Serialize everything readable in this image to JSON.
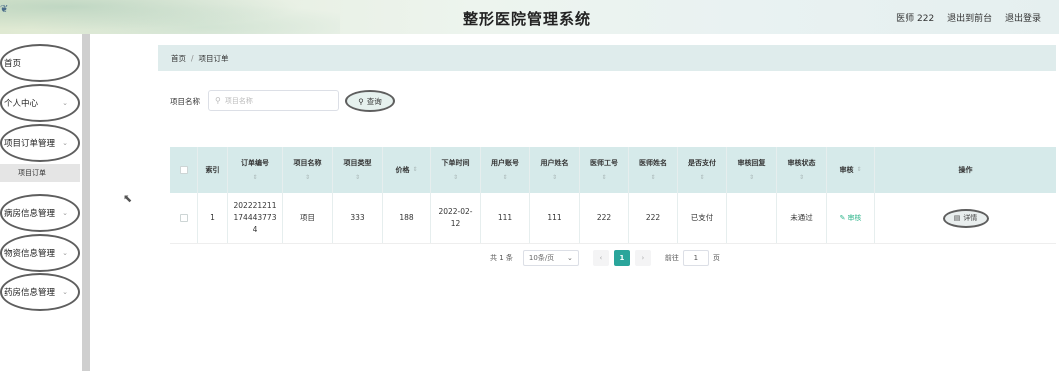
{
  "header": {
    "title": "整形医院管理系统",
    "user": "医师 222",
    "back_front": "退出到前台",
    "logout": "退出登录",
    "logo_icon": "tree-icon"
  },
  "sidebar": {
    "items": [
      {
        "label": "首页"
      },
      {
        "label": "个人中心"
      },
      {
        "label": "项目订单管理"
      },
      {
        "label": "病房信息管理"
      },
      {
        "label": "物资信息管理"
      },
      {
        "label": "药房信息管理"
      }
    ],
    "sub_item": "项目订单",
    "chevron": "⌄"
  },
  "breadcrumb": {
    "home": "首页",
    "sep": "/",
    "current": "项目订单"
  },
  "search": {
    "label": "项目名称",
    "placeholder": "项目名称",
    "button": "查询",
    "icon": "search-icon"
  },
  "table": {
    "headers": [
      "索引",
      "订单编号",
      "项目名称",
      "项目类型",
      "价格",
      "下单时间",
      "用户账号",
      "用户姓名",
      "医师工号",
      "医师姓名",
      "是否支付",
      "审核回复",
      "审核状态",
      "审核",
      "操作"
    ],
    "sort_glyph": "⇕",
    "rows": [
      {
        "index": "1",
        "order_no": "2022212111744437734",
        "project_name": "项目",
        "project_type": "333",
        "price": "188",
        "order_time": "2022-02-12",
        "user_account": "111",
        "user_name": "111",
        "doctor_no": "222",
        "doctor_name": "222",
        "paid": "已支付",
        "reply": "",
        "status": "未通过",
        "audit": "审核",
        "action": "详情"
      }
    ]
  },
  "pagination": {
    "total": "共 1 条",
    "page_size": "10条/页",
    "current_page": "1",
    "goto_label": "前往",
    "goto_value": "1",
    "page_suffix": "页",
    "prev": "‹",
    "next": "›"
  },
  "colors": {
    "accent": "#2aa59b",
    "header_bg": "#d6eaea",
    "link": "#2fb58b"
  }
}
